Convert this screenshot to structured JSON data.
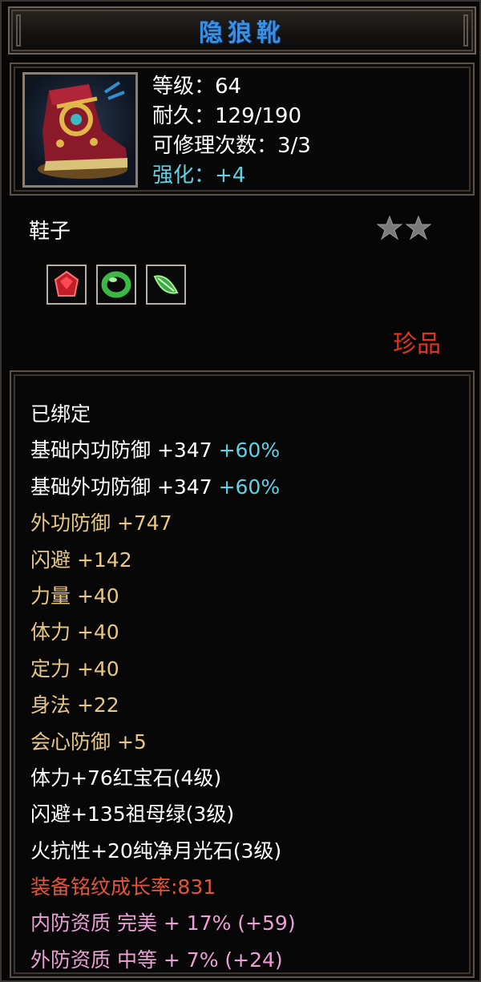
{
  "title": "隐狼靴",
  "header": {
    "icon": "boots-icon",
    "level": "等级：64",
    "durability": "耐久：129/190",
    "repairs": "可修理次数：3/3",
    "enhance": "强化：+4"
  },
  "item_type": "鞋子",
  "stars": 2,
  "gems": [
    {
      "icon": "red-gem-icon",
      "color": "#d42a2a"
    },
    {
      "icon": "green-jade-ring-icon",
      "color": "#3cb845"
    },
    {
      "icon": "green-leaf-gem-icon",
      "color": "#56c65a"
    }
  ],
  "rarity": "珍品",
  "colors": {
    "title": "#3a8fe0",
    "enhance": "#5fd2e6",
    "rarity": "#e0341e",
    "attr_gold": "#e8c783",
    "attr_red": "#e0563c",
    "attr_pink": "#ec9fd4"
  },
  "attributes": {
    "bound": "已绑定",
    "base_inner_def": "基础内功防御 +347",
    "base_inner_def_pct": "+60%",
    "base_outer_def": "基础外功防御 +347",
    "base_outer_def_pct": "+60%",
    "outer_def": "外功防御 +747",
    "dodge": "闪避 +142",
    "strength": "力量 +40",
    "stamina": "体力 +40",
    "focus": "定力 +40",
    "agility": "身法 +22",
    "crit_def": "会心防御 +5",
    "gem1": "体力+76红宝石(4级)",
    "gem2": "闪避+135祖母绿(3级)",
    "gem3": "火抗性+20纯净月光石(3级)",
    "growth": "装备铭纹成长率:831",
    "inner_quality": "内防资质 完美 + 17% (+59)",
    "outer_quality": "外防资质 中等 + 7% (+24)"
  }
}
